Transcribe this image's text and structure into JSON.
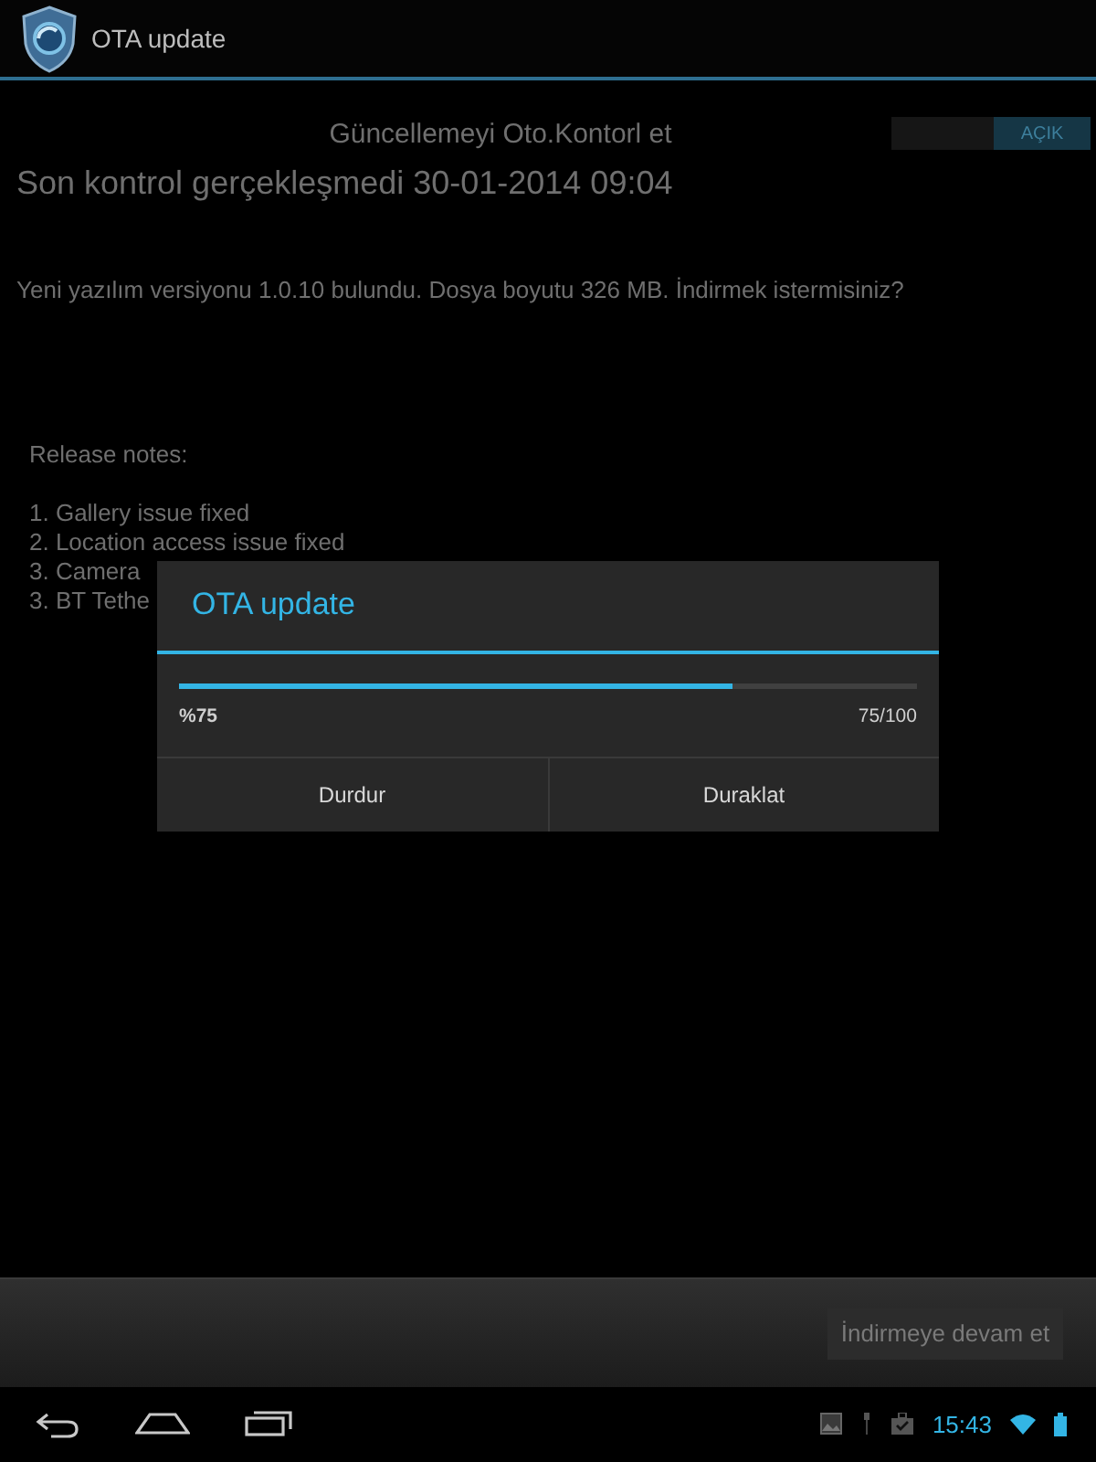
{
  "action_bar": {
    "title": "OTA update"
  },
  "auto_check": {
    "label": "Güncellemeyi Oto.Kontorl et",
    "on": true,
    "state_text": "AÇIK"
  },
  "last_check": "Son kontrol gerçekleşmedi 30-01-2014 09:04",
  "message": "Yeni yazılım versiyonu 1.0.10 bulundu. Dosya boyutu 326 MB. İndirmek istermisiniz?",
  "release_notes": {
    "heading": "Release notes:",
    "items": [
      "1. Gallery issue fixed",
      "2. Location access issue fixed",
      "3. Camera",
      "3. BT Tethe"
    ]
  },
  "dialog": {
    "title": "OTA update",
    "level": 0.75,
    "percent": "%75",
    "count": "75/100",
    "buttons": [
      "Durdur",
      "Duraklat"
    ]
  },
  "bottom_button": "İndirmeye devam et",
  "status_bar": {
    "time": "15:43"
  }
}
